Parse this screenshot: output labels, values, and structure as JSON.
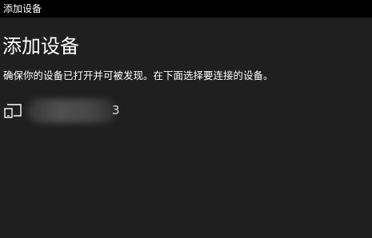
{
  "window": {
    "title": "添加设备"
  },
  "page": {
    "heading": "添加设备",
    "instruction": "确保你的设备已打开并可被发现。在下面选择要连接的设备。"
  },
  "devices": [
    {
      "icon": "display-device-icon",
      "name_visible_suffix": "3"
    }
  ],
  "colors": {
    "titlebar_bg": "#000000",
    "content_bg": "#1f1f1f",
    "text": "#ffffff"
  }
}
